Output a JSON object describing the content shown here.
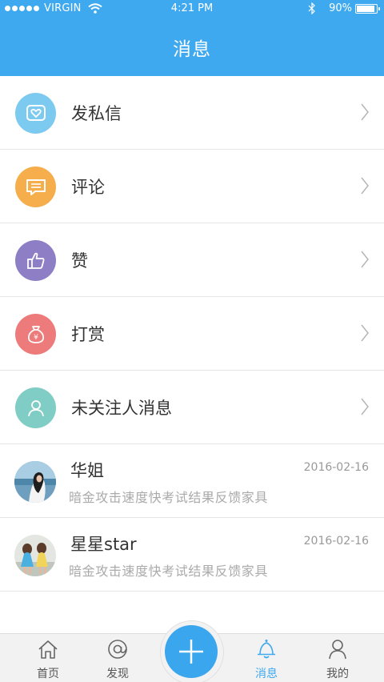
{
  "status_bar": {
    "carrier": "VIRGIN",
    "time": "4:21 PM",
    "battery": "90%"
  },
  "header": {
    "title": "消息"
  },
  "menu": [
    {
      "label": "发私信",
      "icon": "heart-message-icon",
      "color": "#7dcaf0"
    },
    {
      "label": "评论",
      "icon": "comment-icon",
      "color": "#f5ae4b"
    },
    {
      "label": "赞",
      "icon": "thumbs-up-icon",
      "color": "#8e7ec5"
    },
    {
      "label": "打赏",
      "icon": "money-bag-icon",
      "color": "#ee7b7b"
    },
    {
      "label": "未关注人消息",
      "icon": "person-icon",
      "color": "#7fcdc4"
    }
  ],
  "messages": [
    {
      "name": "华姐",
      "date": "2016-02-16",
      "preview": "暗金攻击速度快考试结果反馈家具"
    },
    {
      "name": "星星star",
      "date": "2016-02-16",
      "preview": "暗金攻击速度快考试结果反馈家具"
    }
  ],
  "tabbar": {
    "home": "首页",
    "discover": "发现",
    "messages": "消息",
    "mine": "我的"
  },
  "colors": {
    "accent": "#3fa9ef"
  }
}
